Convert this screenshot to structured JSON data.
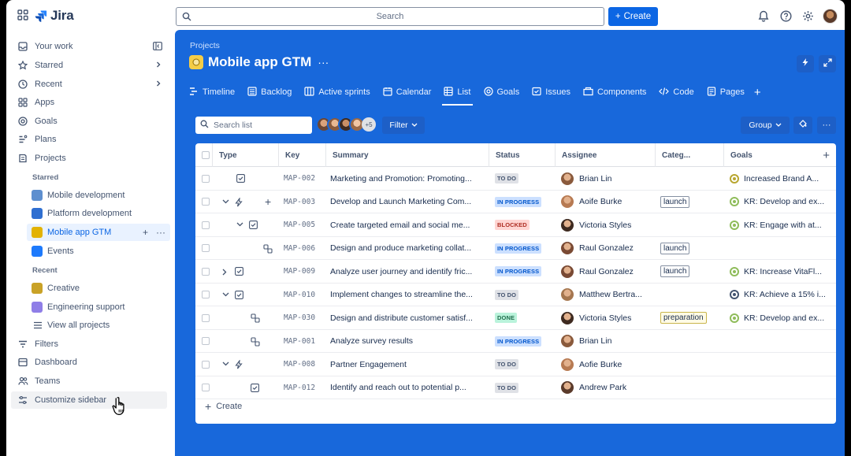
{
  "app": {
    "name": "Jira"
  },
  "search": {
    "placeholder": "Search"
  },
  "create_label": "Create",
  "sidebar": {
    "items_top": [
      {
        "label": "Your work"
      },
      {
        "label": "Starred"
      },
      {
        "label": "Recent"
      },
      {
        "label": "Apps"
      },
      {
        "label": "Goals"
      },
      {
        "label": "Plans"
      },
      {
        "label": "Projects"
      }
    ],
    "starred_heading": "Starred",
    "starred": [
      {
        "label": "Mobile development"
      },
      {
        "label": "Platform development"
      },
      {
        "label": "Mobile app GTM"
      },
      {
        "label": "Events"
      }
    ],
    "recent_heading": "Recent",
    "recent": [
      {
        "label": "Creative"
      },
      {
        "label": "Engineering support"
      },
      {
        "label": "View all projects"
      }
    ],
    "items_bottom": [
      {
        "label": "Filters"
      },
      {
        "label": "Dashboard"
      },
      {
        "label": "Teams"
      },
      {
        "label": "Customize sidebar"
      }
    ]
  },
  "project": {
    "breadcrumb": "Projects",
    "title": "Mobile app GTM",
    "tabs": [
      {
        "label": "Timeline"
      },
      {
        "label": "Backlog"
      },
      {
        "label": "Active sprints"
      },
      {
        "label": "Calendar"
      },
      {
        "label": "List"
      },
      {
        "label": "Goals"
      },
      {
        "label": "Issues"
      },
      {
        "label": "Components"
      },
      {
        "label": "Code"
      },
      {
        "label": "Pages"
      }
    ]
  },
  "toolbar": {
    "search_placeholder": "Search list",
    "people_more": "+5",
    "filter_label": "Filter",
    "group_label": "Group"
  },
  "table": {
    "columns": [
      "Type",
      "Key",
      "Summary",
      "Status",
      "Assignee",
      "Categ...",
      "Goals"
    ],
    "rows": [
      {
        "key": "MAP-002",
        "summary": "Marketing and Promotion: Promoting...",
        "status": "TO DO",
        "assignee": "Brian Lin",
        "category": "",
        "goal": "Increased Brand A..."
      },
      {
        "key": "MAP-003",
        "summary": "Develop and Launch Marketing Com...",
        "status": "IN PROGRESS",
        "assignee": "Aoife Burke",
        "category": "launch",
        "goal": "KR: Develop and ex..."
      },
      {
        "key": "MAP-005",
        "summary": "Create targeted email and social me...",
        "status": "BLOCKED",
        "assignee": "Victoria Styles",
        "category": "",
        "goal": "KR: Engage with at..."
      },
      {
        "key": "MAP-006",
        "summary": "Design and produce marketing collat...",
        "status": "IN PROGRESS",
        "assignee": "Raul Gonzalez",
        "category": "launch",
        "goal": ""
      },
      {
        "key": "MAP-009",
        "summary": "Analyze user journey and identify fric...",
        "status": "IN PROGRESS",
        "assignee": "Raul Gonzalez",
        "category": "launch",
        "goal": "KR: Increase VitaFl..."
      },
      {
        "key": "MAP-010",
        "summary": "Implement changes to streamline the...",
        "status": "TO DO",
        "assignee": "Matthew Bertra...",
        "category": "",
        "goal": "KR: Achieve a 15% i..."
      },
      {
        "key": "MAP-030",
        "summary": "Design and distribute customer satisf...",
        "status": "DONE",
        "assignee": "Victoria Styles",
        "category": "preparation",
        "goal": "KR: Develop and ex..."
      },
      {
        "key": "MAP-001",
        "summary": "Analyze survey results",
        "status": "IN PROGRESS",
        "assignee": "Brian Lin",
        "category": "",
        "goal": ""
      },
      {
        "key": "MAP-008",
        "summary": "Partner Engagement",
        "status": "TO DO",
        "assignee": "Aofie Burke",
        "category": "",
        "goal": ""
      },
      {
        "key": "MAP-012",
        "summary": "Identify and reach out to potential p...",
        "status": "TO DO",
        "assignee": "Andrew Park",
        "category": "",
        "goal": ""
      }
    ],
    "create_label": "Create"
  }
}
